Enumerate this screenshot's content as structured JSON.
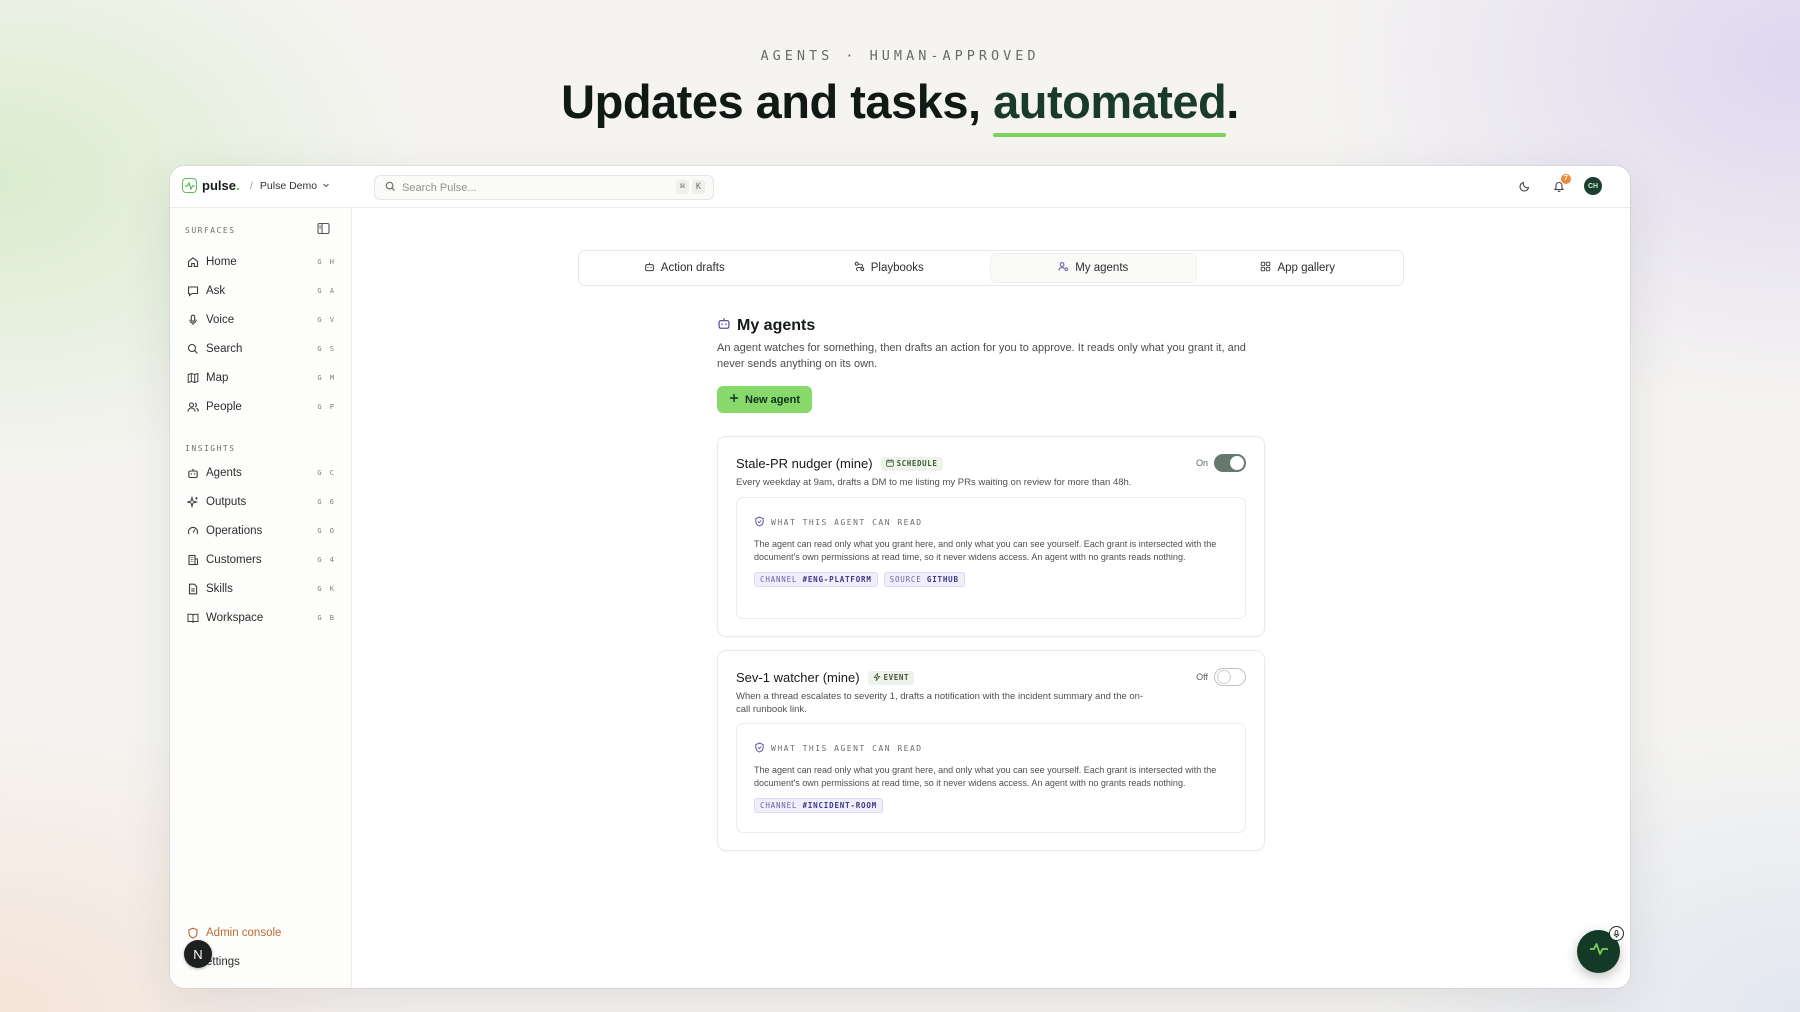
{
  "hero": {
    "eyebrow": "AGENTS · HUMAN-APPROVED",
    "title_main": "Updates and tasks, ",
    "title_accent": "automated",
    "title_end": "."
  },
  "topbar": {
    "logo": "pulse",
    "logo_dot": ".",
    "workspace": "Pulse Demo",
    "search_placeholder": "Search Pulse...",
    "search_kbd": [
      "⌘",
      "K"
    ],
    "notification_count": "7",
    "avatar_initials": "CH"
  },
  "sidebar": {
    "surfaces_heading": "SURFACES",
    "surfaces": [
      {
        "label": "Home",
        "kbd": "G H",
        "icon": "home-icon"
      },
      {
        "label": "Ask",
        "kbd": "G A",
        "icon": "chat-icon"
      },
      {
        "label": "Voice",
        "kbd": "G V",
        "icon": "mic-icon"
      },
      {
        "label": "Search",
        "kbd": "G S",
        "icon": "search-icon"
      },
      {
        "label": "Map",
        "kbd": "G M",
        "icon": "map-icon"
      },
      {
        "label": "People",
        "kbd": "G P",
        "icon": "people-icon"
      }
    ],
    "insights_heading": "INSIGHTS",
    "insights": [
      {
        "label": "Agents",
        "kbd": "G C",
        "icon": "bot-icon"
      },
      {
        "label": "Outputs",
        "kbd": "G 6",
        "icon": "sparkle-icon"
      },
      {
        "label": "Operations",
        "kbd": "G O",
        "icon": "gauge-icon"
      },
      {
        "label": "Customers",
        "kbd": "G 4",
        "icon": "building-icon"
      },
      {
        "label": "Skills",
        "kbd": "G K",
        "icon": "file-icon"
      },
      {
        "label": "Workspace",
        "kbd": "G B",
        "icon": "book-icon"
      }
    ],
    "admin_console": "Admin console",
    "settings": "ettings",
    "n_badge": "N"
  },
  "tabs": [
    {
      "label": "Action drafts",
      "icon": "bot-icon",
      "active": false
    },
    {
      "label": "Playbooks",
      "icon": "route-icon",
      "active": false
    },
    {
      "label": "My agents",
      "icon": "user-cog-icon",
      "active": true
    },
    {
      "label": "App gallery",
      "icon": "grid-icon",
      "active": false
    }
  ],
  "main": {
    "title": "My agents",
    "description": "An agent watches for something, then drafts an action for you to approve. It reads only what you grant it, and never sends anything on its own.",
    "new_agent_button": "New agent"
  },
  "agents": [
    {
      "name": "Stale-PR nudger (mine)",
      "trigger": "SCHEDULE",
      "trigger_icon": "calendar-icon",
      "description": "Every weekday at 9am, drafts a DM to me listing my PRs waiting on review for more than 48h.",
      "status_label": "On",
      "enabled": true,
      "reads_heading": "WHAT THIS AGENT CAN READ",
      "reads_body": "The agent can read only what you grant here, and only what you can see yourself. Each grant is intersected with the document's own permissions at read time, so it never widens access. An agent with no grants reads nothing.",
      "grants": [
        {
          "kind": "CHANNEL",
          "value": "#ENG-PLATFORM"
        },
        {
          "kind": "SOURCE",
          "value": "GITHUB"
        }
      ]
    },
    {
      "name": "Sev-1 watcher (mine)",
      "trigger": "EVENT",
      "trigger_icon": "bolt-icon",
      "description": "When a thread escalates to severity 1, drafts a notification with the incident summary and the on-call runbook link.",
      "status_label": "Off",
      "enabled": false,
      "reads_heading": "WHAT THIS AGENT CAN READ",
      "reads_body": "The agent can read only what you grant here, and only what you can see yourself. Each grant is intersected with the document's own permissions at read time, so it never widens access. An agent with no grants reads nothing.",
      "grants": [
        {
          "kind": "CHANNEL",
          "value": "#INCIDENT-ROOM"
        }
      ]
    }
  ],
  "colors": {
    "brand_green": "#86d96a",
    "accent_underline": "#7ed15e",
    "dark_green": "#133a27",
    "admin_orange": "#b86a34",
    "grant_purple": "#6d65a8"
  }
}
